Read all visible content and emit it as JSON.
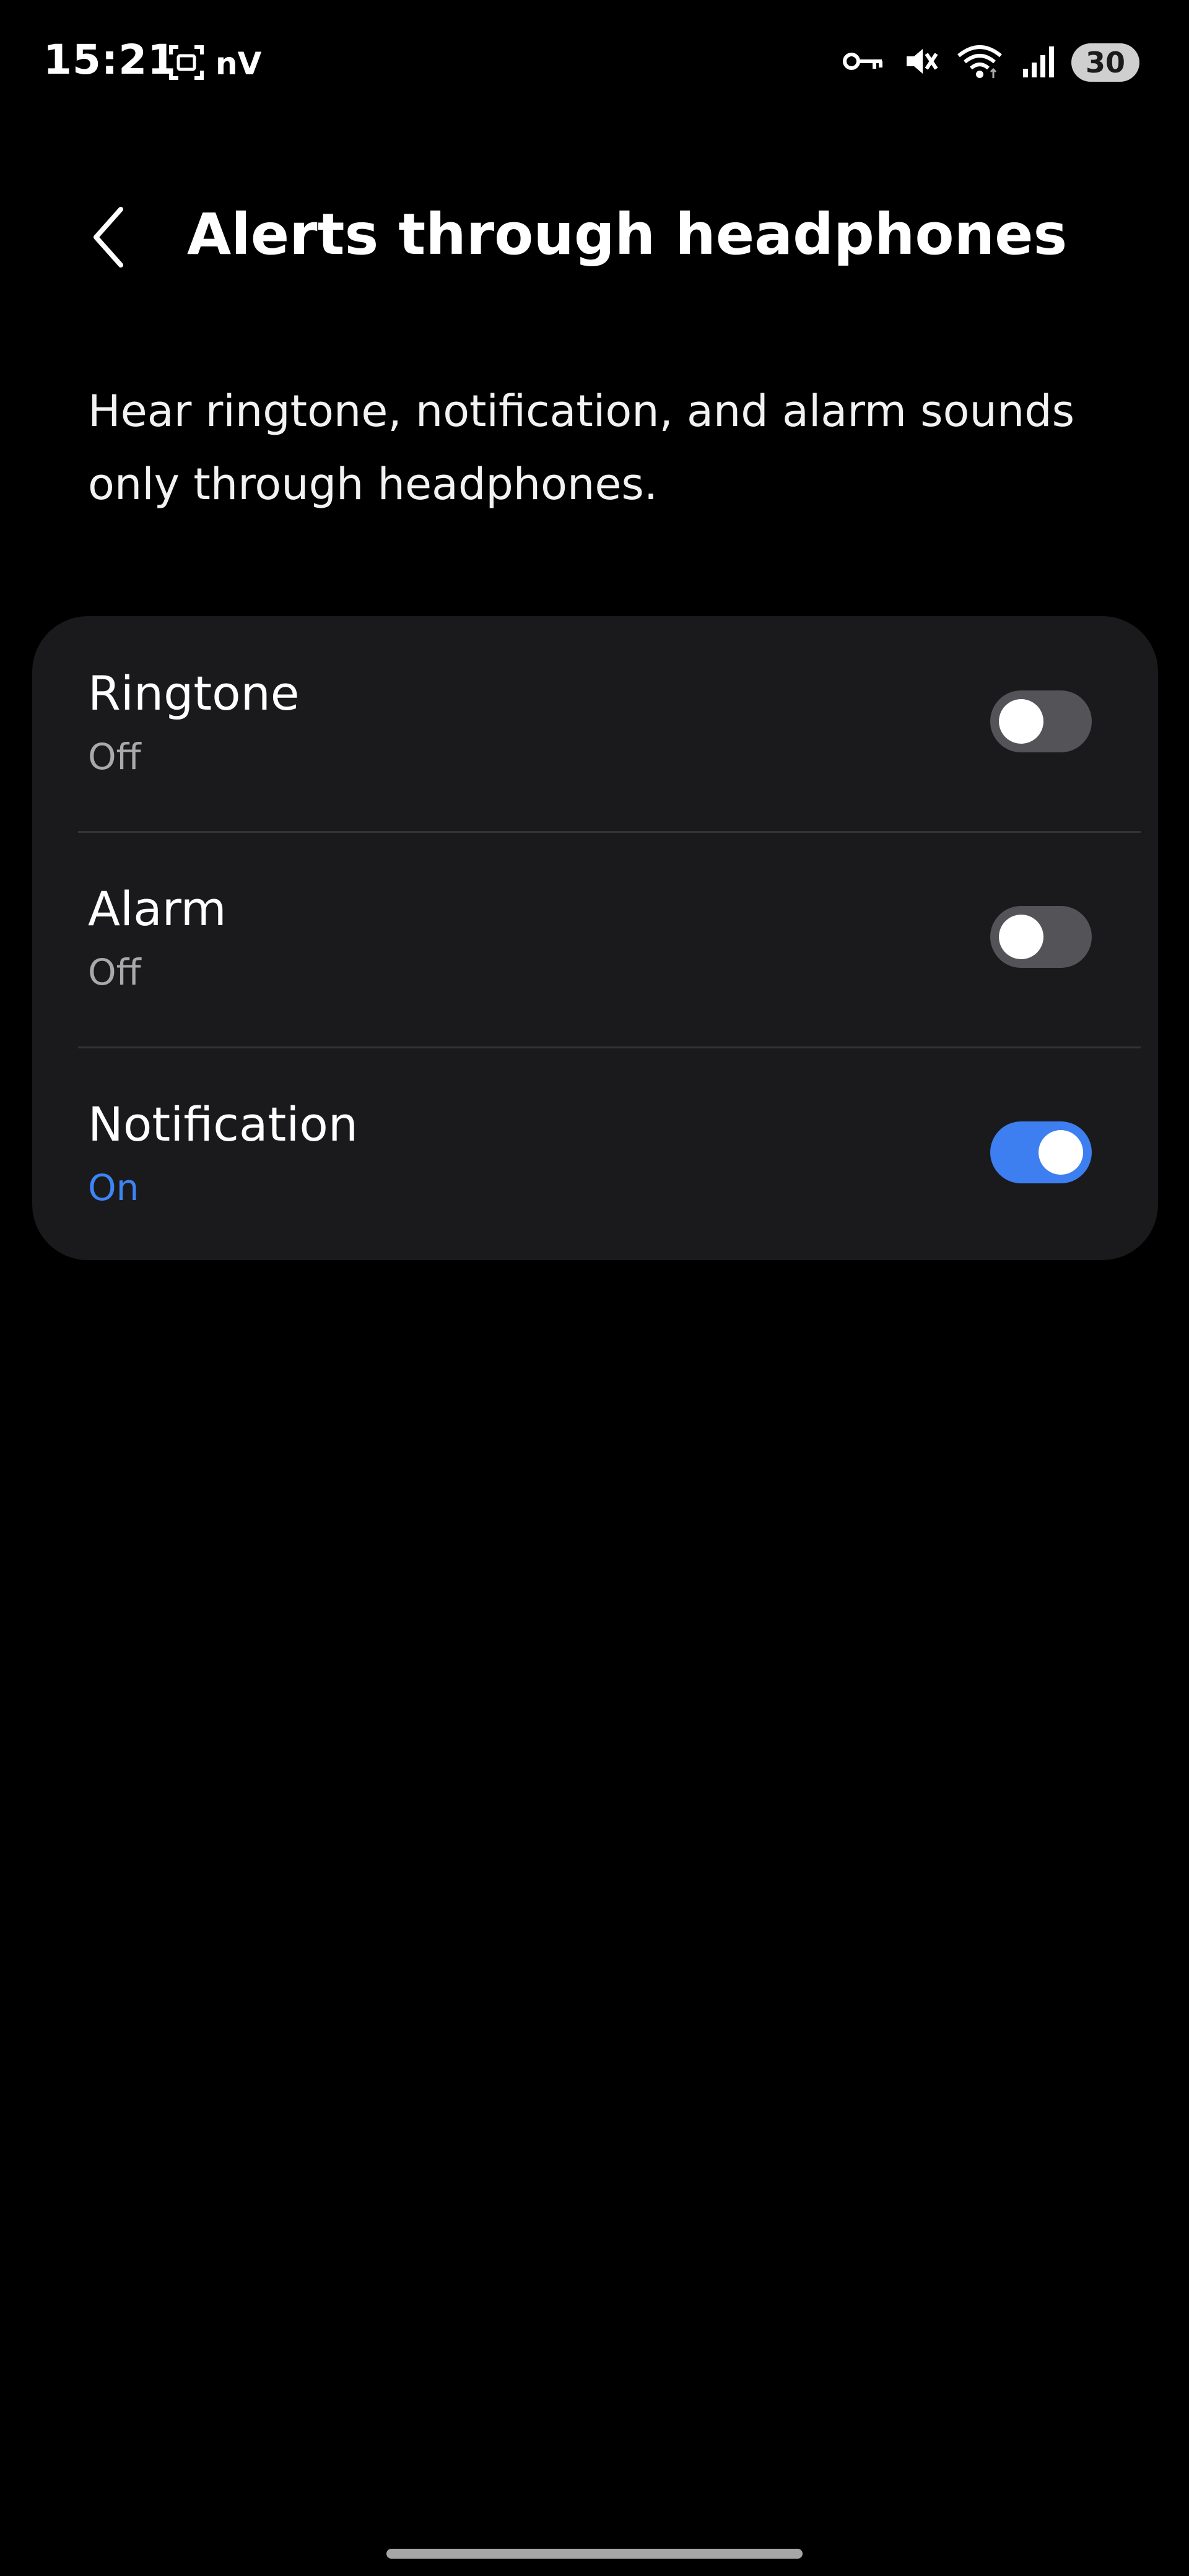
{
  "status_bar": {
    "time": "15:21",
    "carrier_text": "nV",
    "battery": "30",
    "icons": [
      "screenshot-icon",
      "vpn-key-icon",
      "mute-icon",
      "wifi-icon",
      "signal-icon",
      "battery-icon"
    ]
  },
  "header": {
    "title": "Alerts through headphones",
    "back_icon": "chevron-left-icon"
  },
  "description": "Hear ringtone, notification, and alarm sounds only through headphones.",
  "settings": [
    {
      "label": "Ringtone",
      "status": "Off",
      "enabled": false
    },
    {
      "label": "Alarm",
      "status": "Off",
      "enabled": false
    },
    {
      "label": "Notification",
      "status": "On",
      "enabled": true
    }
  ],
  "colors": {
    "background": "#000000",
    "card": "#1a1a1c",
    "accent": "#3d84f5",
    "toggle_off": "#545458"
  }
}
